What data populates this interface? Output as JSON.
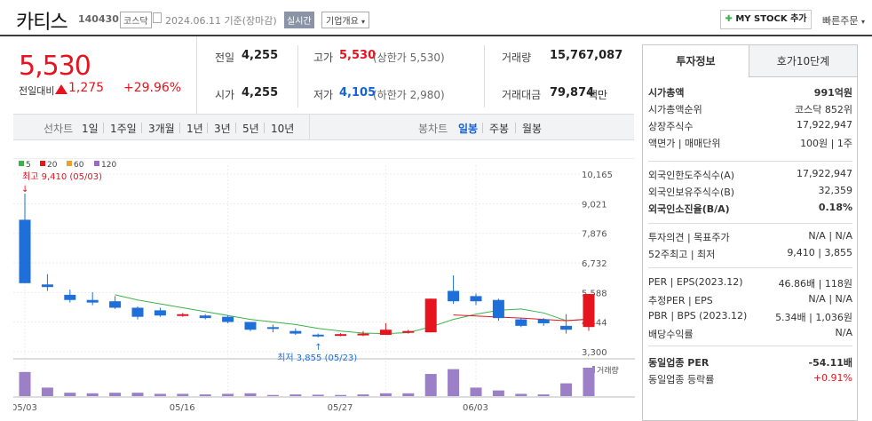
{
  "header": {
    "name": "카티스",
    "code": "140430",
    "market": "코스닥",
    "date": "2024.06.11 기준(장마감)",
    "realtime": "실시간",
    "corp_info": "기업개요",
    "mystock": "MY STOCK 추가",
    "quick_order": "빠른주문"
  },
  "quote": {
    "price": "5,530",
    "change_label": "전일대비",
    "change": "1,275",
    "change_pct": "+29.96%",
    "prev_label": "전일",
    "prev": "4,255",
    "open_label": "시가",
    "open": "4,255",
    "high_label": "고가",
    "high": "5,530",
    "upper_limit": "(상한가 5,530)",
    "low_label": "저가",
    "low": "4,105",
    "lower_limit": "(하한가 2,980)",
    "volume_label": "거래량",
    "volume": "15,767,087",
    "amount_label": "거래대금",
    "amount": "79,874",
    "amount_unit": "백만"
  },
  "period_tabs": {
    "line_label": "선차트",
    "items": [
      "1일",
      "1주일",
      "3개월",
      "1년",
      "3년",
      "5년",
      "10년"
    ],
    "candle_label": "봉차트",
    "candle_items": [
      "일봉",
      "주봉",
      "월봉"
    ],
    "active": "일봉"
  },
  "chart_data": {
    "type": "candlestick",
    "legend": [
      "5",
      "20",
      "60",
      "120"
    ],
    "ma_colors": {
      "5": "#3bb34a",
      "20": "#e5141f",
      "60": "#f29e2e",
      "120": "#9b6bc3"
    },
    "y_ticks": [
      "10,165",
      "9,021",
      "7,876",
      "6,732",
      "5,588",
      "4,444",
      "3,300"
    ],
    "x_ticks": [
      "05/03",
      "05/16",
      "05/27",
      "06/03"
    ],
    "max_annotation": "최고 9,410 (05/03)",
    "min_annotation": "최저 3,855 (05/23)",
    "volume_label": "거래량",
    "candles": [
      {
        "o": 8400,
        "c": 5950,
        "h": 9410,
        "l": 5950,
        "v": 0.85
      },
      {
        "o": 5900,
        "c": 5800,
        "h": 6300,
        "l": 5650,
        "v": 0.3
      },
      {
        "o": 5500,
        "c": 5300,
        "h": 5700,
        "l": 5200,
        "v": 0.12
      },
      {
        "o": 5300,
        "c": 5200,
        "h": 5600,
        "l": 5100,
        "v": 0.1
      },
      {
        "o": 5250,
        "c": 5000,
        "h": 5450,
        "l": 4950,
        "v": 0.12
      },
      {
        "o": 5000,
        "c": 4650,
        "h": 5050,
        "l": 4550,
        "v": 0.12
      },
      {
        "o": 4900,
        "c": 4700,
        "h": 5000,
        "l": 4650,
        "v": 0.08
      },
      {
        "o": 4700,
        "c": 4750,
        "h": 4800,
        "l": 4650,
        "v": 0.08
      },
      {
        "o": 4700,
        "c": 4600,
        "h": 4750,
        "l": 4550,
        "v": 0.06
      },
      {
        "o": 4650,
        "c": 4450,
        "h": 4700,
        "l": 4400,
        "v": 0.08
      },
      {
        "o": 4450,
        "c": 4150,
        "h": 4450,
        "l": 4100,
        "v": 0.1
      },
      {
        "o": 4250,
        "c": 4200,
        "h": 4350,
        "l": 4050,
        "v": 0.04
      },
      {
        "o": 4100,
        "c": 4000,
        "h": 4200,
        "l": 3950,
        "v": 0.06
      },
      {
        "o": 3960,
        "c": 3900,
        "h": 4000,
        "l": 3855,
        "v": 0.05
      },
      {
        "o": 3950,
        "c": 3980,
        "h": 4020,
        "l": 3900,
        "v": 0.04
      },
      {
        "o": 3950,
        "c": 4000,
        "h": 4100,
        "l": 3900,
        "v": 0.06
      },
      {
        "o": 3950,
        "c": 4150,
        "h": 4400,
        "l": 3950,
        "v": 0.1
      },
      {
        "o": 4050,
        "c": 4100,
        "h": 4150,
        "l": 4000,
        "v": 0.1
      },
      {
        "o": 4050,
        "c": 5350,
        "h": 5350,
        "l": 4050,
        "v": 0.78
      },
      {
        "o": 5650,
        "c": 5250,
        "h": 6250,
        "l": 5150,
        "v": 0.95
      },
      {
        "o": 5450,
        "c": 5250,
        "h": 5550,
        "l": 5100,
        "v": 0.3
      },
      {
        "o": 5300,
        "c": 4600,
        "h": 5350,
        "l": 4500,
        "v": 0.2
      },
      {
        "o": 4550,
        "c": 4300,
        "h": 4600,
        "l": 4250,
        "v": 0.08
      },
      {
        "o": 4550,
        "c": 4400,
        "h": 4600,
        "l": 4300,
        "v": 0.06
      },
      {
        "o": 4300,
        "c": 4150,
        "h": 4750,
        "l": 4000,
        "v": 0.45
      },
      {
        "o": 4255,
        "c": 5530,
        "h": 5530,
        "l": 4105,
        "v": 1.0
      }
    ],
    "ma5": [
      null,
      null,
      null,
      null,
      5500,
      5300,
      5150,
      5000,
      4850,
      4700,
      4550,
      4450,
      4350,
      4200,
      4100,
      4020,
      4000,
      4040,
      4260,
      4550,
      4750,
      4900,
      4950,
      4800,
      4500,
      4550
    ],
    "ma20": [
      null,
      null,
      null,
      null,
      null,
      null,
      null,
      null,
      null,
      null,
      null,
      null,
      null,
      null,
      null,
      null,
      null,
      null,
      null,
      4720,
      4680,
      4640,
      4600,
      4550,
      4500,
      4560
    ]
  },
  "side": {
    "tab_invest": "투자정보",
    "tab_hoga": "호가10단계",
    "rows1": [
      {
        "label": "시가총액",
        "value": "991억원"
      },
      {
        "label": "시가총액순위",
        "value": "코스닥 852위"
      },
      {
        "label": "상장주식수",
        "value": "17,922,947"
      },
      {
        "label": "액면가 | 매매단위",
        "value": "100원 | 1주"
      }
    ],
    "rows2": [
      {
        "label": "외국인한도주식수(A)",
        "value": "17,922,947"
      },
      {
        "label": "외국인보유주식수(B)",
        "value": "32,359"
      },
      {
        "label": "외국인소진율(B/A)",
        "value": "0.18%"
      }
    ],
    "rows3": [
      {
        "label": "투자의견 | 목표주가",
        "value": "N/A | N/A"
      },
      {
        "label": "52주최고 | 최저",
        "value": "9,410 | 3,855"
      }
    ],
    "rows4": [
      {
        "label": "PER | EPS(2023.12)",
        "value": "46.86배 | 118원"
      },
      {
        "label": "추정PER | EPS",
        "value": "N/A | N/A"
      },
      {
        "label": "PBR | BPS (2023.12)",
        "value": "5.34배 | 1,036원"
      },
      {
        "label": "배당수익률",
        "value": "N/A"
      }
    ],
    "rows5": [
      {
        "label": "동일업종 PER",
        "value": "-54.11배"
      },
      {
        "label": "동일업종 등락률",
        "value": "+0.91%"
      }
    ]
  }
}
